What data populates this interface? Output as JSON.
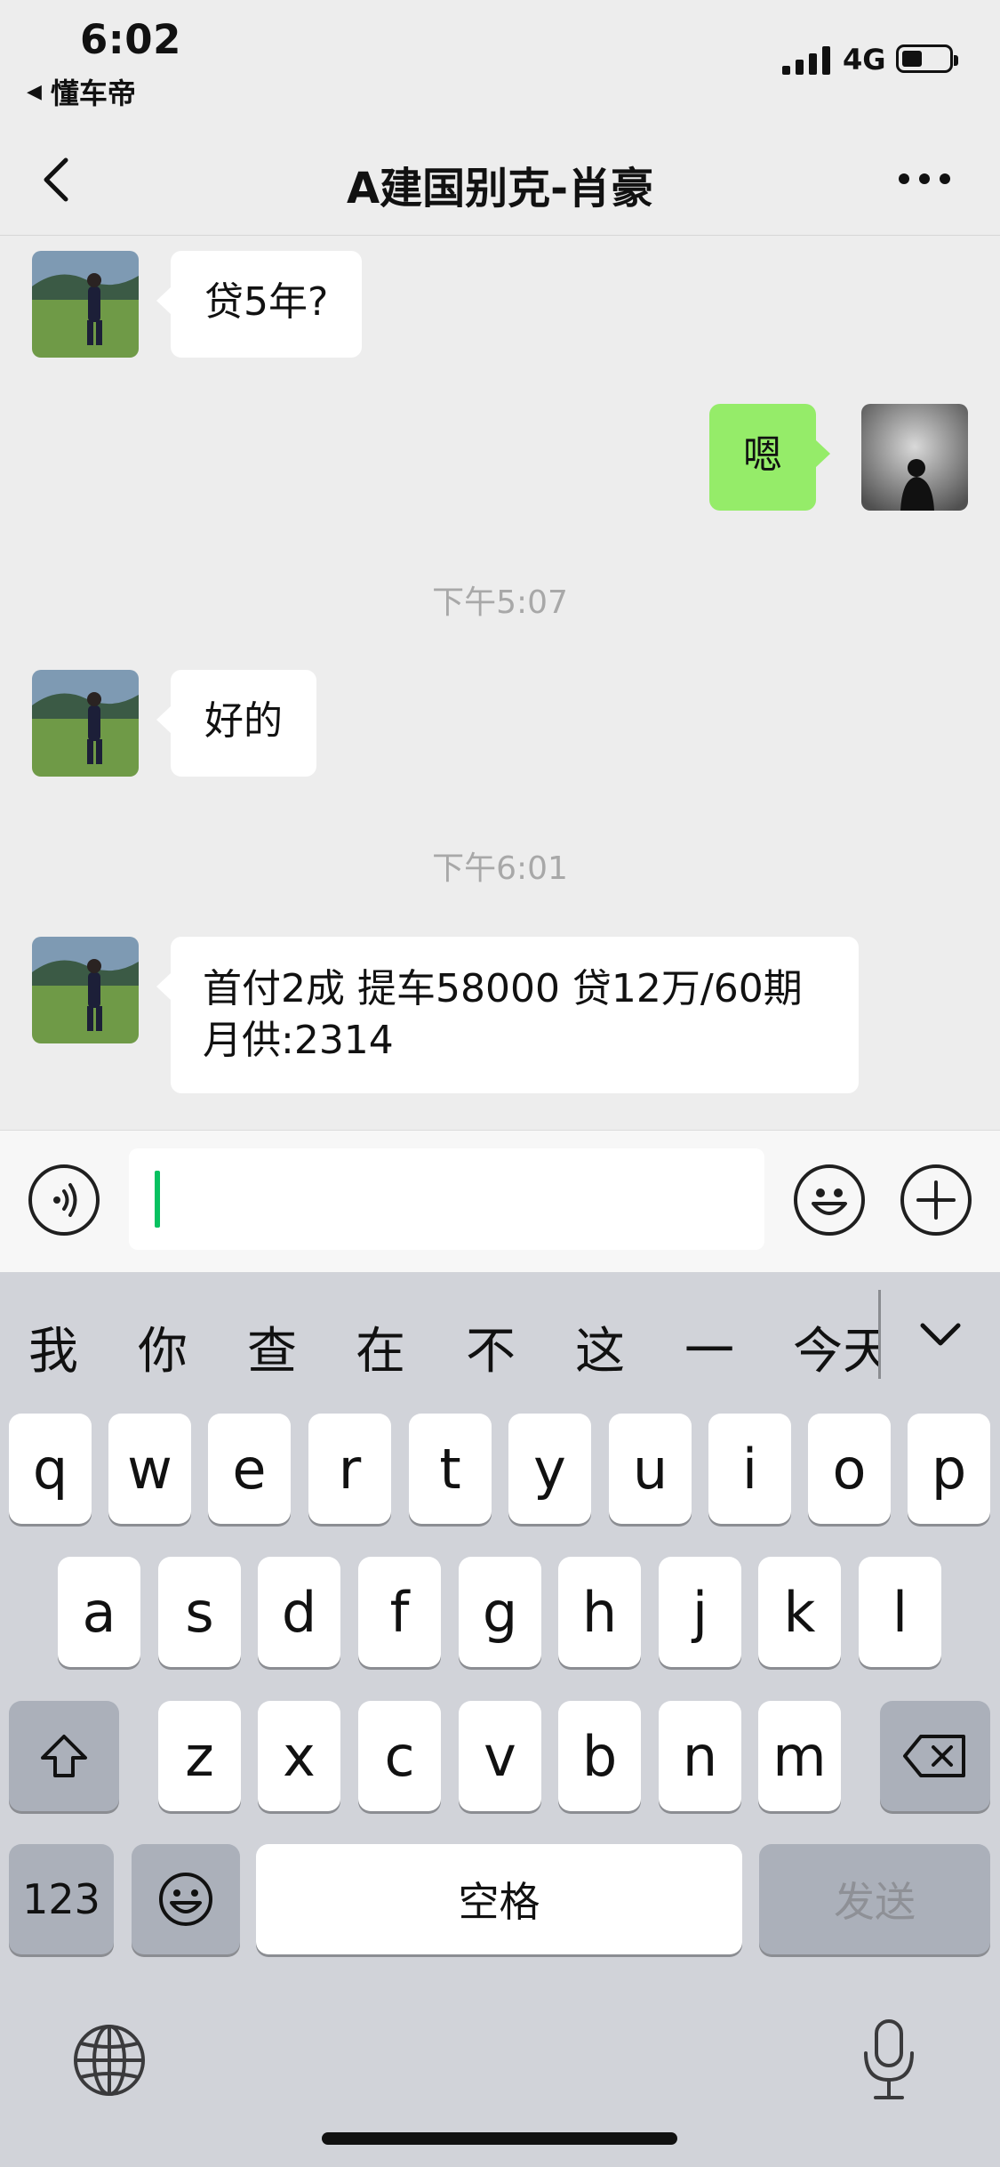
{
  "status_bar": {
    "time": "6:02",
    "back_app": "懂车帝",
    "network": "4G"
  },
  "nav": {
    "title": "A建国别克-肖豪"
  },
  "messages": [
    {
      "side": "left",
      "text": "贷5年?"
    },
    {
      "side": "right",
      "text": "嗯"
    },
    {
      "type": "time",
      "text": "下午5:07"
    },
    {
      "side": "left",
      "text": "好的"
    },
    {
      "type": "time",
      "text": "下午6:01"
    },
    {
      "side": "left",
      "text": "首付2成 提车58000 贷12万/60期 月供:2314"
    }
  ],
  "candidates": [
    "我",
    "你",
    "查",
    "在",
    "不",
    "这",
    "一",
    "今天"
  ],
  "keyboard": {
    "row1": [
      "q",
      "w",
      "e",
      "r",
      "t",
      "y",
      "u",
      "i",
      "o",
      "p"
    ],
    "row2": [
      "a",
      "s",
      "d",
      "f",
      "g",
      "h",
      "j",
      "k",
      "l"
    ],
    "row3": [
      "z",
      "x",
      "c",
      "v",
      "b",
      "n",
      "m"
    ],
    "numbers_key": "123",
    "space_key": "空格",
    "send_key": "发送"
  },
  "colors": {
    "chat_bg": "#ededed",
    "self_bubble": "#95ec69",
    "caret": "#07c160",
    "keyboard_bg": "#d1d3d9"
  },
  "icons": [
    "back-chevron-icon",
    "more-icon",
    "voice-icon",
    "emoji-icon",
    "plus-icon",
    "chevron-down-icon",
    "shift-icon",
    "backspace-icon",
    "emoji-key-icon",
    "globe-icon",
    "microphone-icon"
  ]
}
